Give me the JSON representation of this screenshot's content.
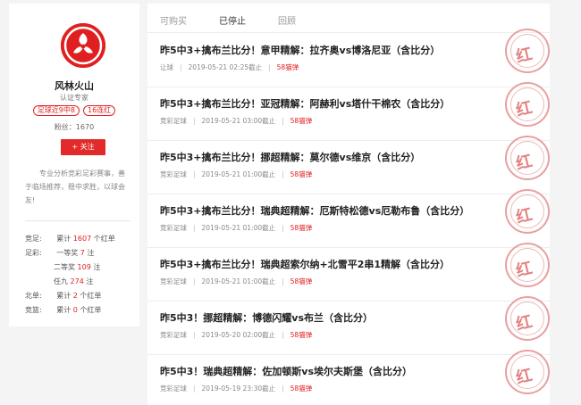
{
  "profile": {
    "name": "风林火山",
    "role": "认证专家",
    "tags": [
      "足球近9中8",
      "16连红"
    ],
    "fans": "粉丝：1670",
    "follow_label": "+ 关注",
    "bio": "专业分析竞彩足彩赛事，善于临场推荐，稳中求胜，以球会友!",
    "stats": {
      "jingcai": {
        "label": "竞足:",
        "text1": "累计 ",
        "value": "1607",
        "text2": " 个红单"
      },
      "zucai": {
        "label": "足彩:",
        "first": {
          "text1": "一等奖 ",
          "value": "7",
          "text2": " 注"
        },
        "second": {
          "text1": "二等奖 ",
          "value": "109",
          "text2": " 注"
        },
        "renjiu": {
          "text1": "任九 ",
          "value": "274",
          "text2": " 注"
        }
      },
      "beidan": {
        "label": "北单:",
        "text1": "累计 ",
        "value": "2",
        "text2": " 个红单"
      },
      "jinglan": {
        "label": "竞篮:",
        "text1": "累计 ",
        "value": "0",
        "text2": " 个红单"
      }
    }
  },
  "tabs": [
    "可购买",
    "已停止",
    "回顾"
  ],
  "colors": {
    "accent": "#e02020",
    "stamp": "#e38383"
  },
  "items": [
    {
      "title": "昨5中3+擒布兰比分！意甲精解：拉齐奥vs博洛尼亚（含比分）",
      "type": "让球",
      "time": "2019-05-21 02:25截止",
      "price": "58猫弹",
      "stamp": "红"
    },
    {
      "title": "昨5中3+擒布兰比分！亚冠精解：阿赫利vs塔什干棉农（含比分）",
      "type": "竞彩足球",
      "time": "2019-05-21 03:00截止",
      "price": "58猫弹",
      "stamp": "红"
    },
    {
      "title": "昨5中3+擒布兰比分！挪超精解：莫尔德vs维京（含比分）",
      "type": "竞彩足球",
      "time": "2019-05-21 01:00截止",
      "price": "58猫弹",
      "stamp": "红"
    },
    {
      "title": "昨5中3+擒布兰比分！瑞典超精解：厄斯特松德vs厄勒布鲁（含比分）",
      "type": "竞彩足球",
      "time": "2019-05-21 01:00截止",
      "price": "58猫弹",
      "stamp": "红"
    },
    {
      "title": "昨5中3+擒布兰比分！瑞典超索尔纳+北雪平2串1精解（含比分）",
      "type": "竞彩足球",
      "time": "2019-05-21 01:00截止",
      "price": "58猫弹",
      "stamp": "红"
    },
    {
      "title": "昨5中3！挪超精解：博德闪耀vs布兰（含比分）",
      "type": "竞彩足球",
      "time": "2019-05-20 02:00截止",
      "price": "58猫弹",
      "stamp": "红"
    },
    {
      "title": "昨5中3！瑞典超精解：佐加顿斯vs埃尔夫斯堡（含比分）",
      "type": "竞彩足球",
      "time": "2019-05-19 23:30截止",
      "price": "58猫弹",
      "stamp": "红"
    }
  ]
}
